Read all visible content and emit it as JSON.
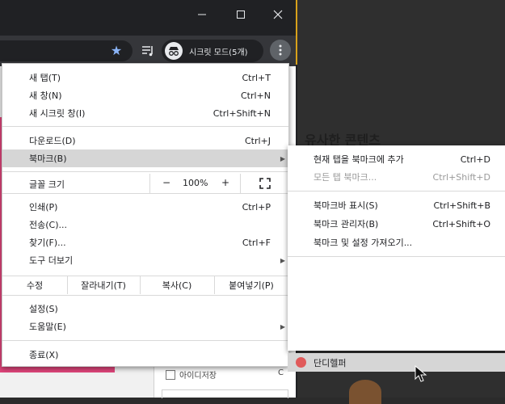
{
  "browser": {
    "window_controls": {
      "minimize": "—",
      "maximize": "☐",
      "close": "✕"
    },
    "toolbar": {
      "star_icon": "star-icon",
      "reading_list_icon": "reading-list-icon",
      "incognito_label": "시크릿 모드(5개)",
      "menu_icon": "kebab-menu-icon"
    }
  },
  "page": {
    "heading_partial": "유사한 콘텐츠",
    "checkbox_label": "아이디저장",
    "right_char": "C"
  },
  "main_menu": {
    "items": [
      {
        "label": "새 탭(T)",
        "shortcut": "Ctrl+T"
      },
      {
        "label": "새 창(N)",
        "shortcut": "Ctrl+N"
      },
      {
        "label": "새 시크릿 창(I)",
        "shortcut": "Ctrl+Shift+N"
      },
      {
        "label": "다운로드(D)",
        "shortcut": "Ctrl+J"
      },
      {
        "label": "북마크(B)",
        "shortcut": ""
      },
      {
        "label": "인쇄(P)",
        "shortcut": "Ctrl+P"
      },
      {
        "label": "전송(C)...",
        "shortcut": ""
      },
      {
        "label": "찾기(F)...",
        "shortcut": "Ctrl+F"
      },
      {
        "label": "도구 더보기",
        "shortcut": ""
      },
      {
        "label": "설정(S)",
        "shortcut": ""
      },
      {
        "label": "도움말(E)",
        "shortcut": ""
      },
      {
        "label": "종료(X)",
        "shortcut": ""
      }
    ],
    "zoom": {
      "label": "글꼴 크기",
      "minus": "−",
      "value": "100%",
      "plus": "+"
    },
    "edit": {
      "label": "수정",
      "cut": "잘라내기(T)",
      "copy": "복사(C)",
      "paste": "붙여넣기(P)"
    }
  },
  "bookmark_submenu": {
    "items": [
      {
        "label": "현재 탭을 북마크에 추가",
        "shortcut": "Ctrl+D"
      },
      {
        "label": "모든 탭 북마크...",
        "shortcut": "Ctrl+Shift+D"
      },
      {
        "label": "북마크바 표시(S)",
        "shortcut": "Ctrl+Shift+B"
      },
      {
        "label": "북마크 관리자(B)",
        "shortcut": "Ctrl+Shift+O"
      },
      {
        "label": "북마크 및 설정 가져오기...",
        "shortcut": ""
      }
    ],
    "bookmark_entry": "단디헬퍼"
  },
  "colors": {
    "accent_pink": "#e0457b",
    "highlight": "#d6d6d6",
    "star_blue": "#8ab4f8"
  }
}
